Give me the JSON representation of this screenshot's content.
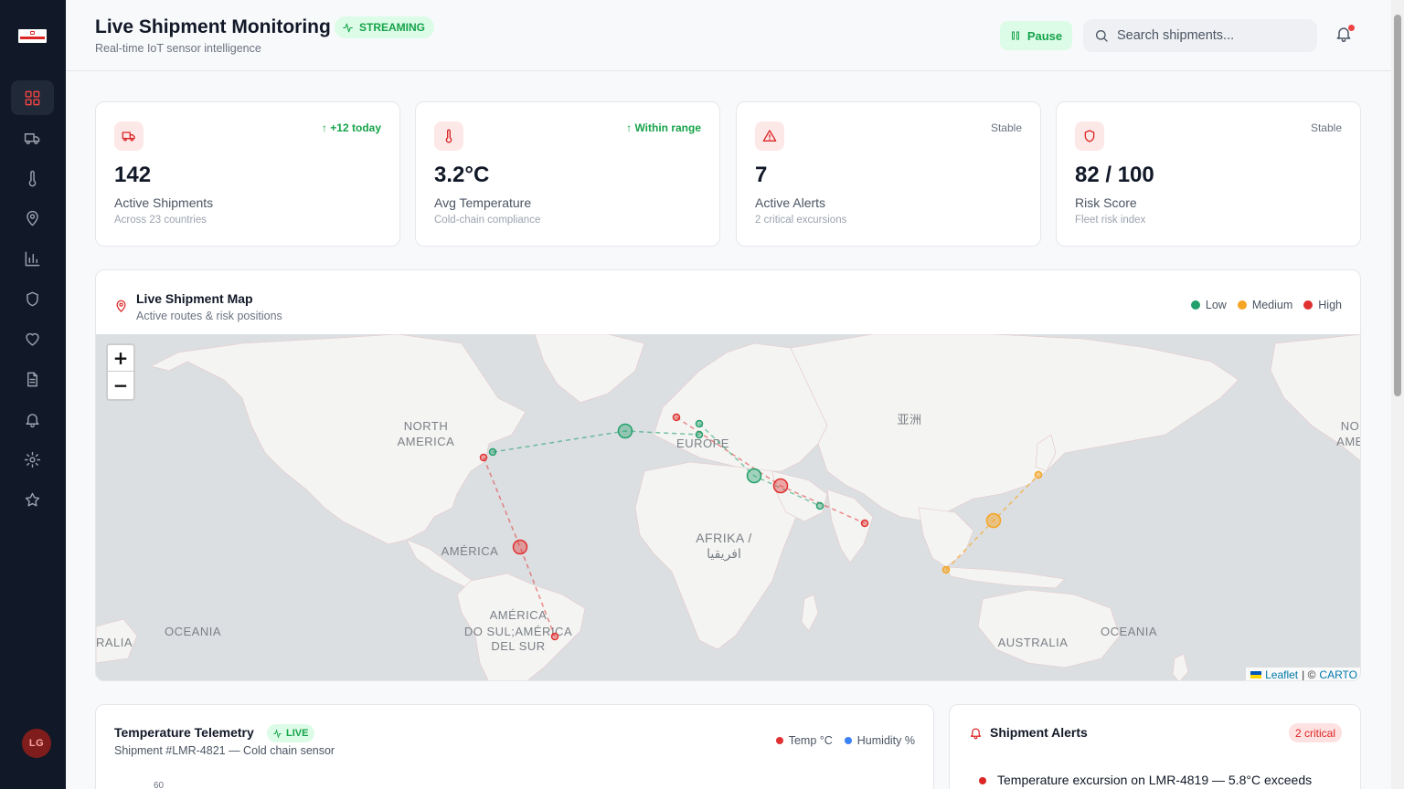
{
  "app": {
    "logo_text": "LAMBERGOLDBERG"
  },
  "sidebar": {
    "items": [
      {
        "name": "dashboard",
        "icon": "grid-icon"
      },
      {
        "name": "shipments",
        "icon": "truck-icon"
      },
      {
        "name": "temperature",
        "icon": "thermometer-icon"
      },
      {
        "name": "locations",
        "icon": "map-pin-icon"
      },
      {
        "name": "analytics",
        "icon": "bar-chart-icon"
      },
      {
        "name": "security",
        "icon": "shield-icon"
      },
      {
        "name": "health",
        "icon": "heart-icon"
      },
      {
        "name": "reports",
        "icon": "document-icon"
      },
      {
        "name": "notifications",
        "icon": "bell-icon"
      },
      {
        "name": "settings",
        "icon": "gear-icon"
      },
      {
        "name": "favorites",
        "icon": "star-icon"
      }
    ],
    "user_initials": "LG"
  },
  "header": {
    "title": "Live Shipment Monitoring",
    "badge": "STREAMING",
    "subtitle": "Real-time IoT sensor intelligence",
    "pause_label": "Pause",
    "search_placeholder": "Search shipments..."
  },
  "stats": [
    {
      "icon": "truck-icon",
      "trend": "↑ +12 today",
      "trend_type": "up",
      "value": "142",
      "label": "Active Shipments",
      "sub": "Across 23 countries"
    },
    {
      "icon": "thermometer-icon",
      "trend": "↑ Within range",
      "trend_type": "up",
      "value": "3.2°C",
      "label": "Avg Temperature",
      "sub": "Cold-chain compliance"
    },
    {
      "icon": "alert-triangle-icon",
      "trend": "Stable",
      "trend_type": "neutral",
      "value": "7",
      "label": "Active Alerts",
      "sub": "2 critical excursions"
    },
    {
      "icon": "shield-icon",
      "trend": "Stable",
      "trend_type": "neutral",
      "value": "82 / 100",
      "label": "Risk Score",
      "sub": "Fleet risk index"
    }
  ],
  "map": {
    "title": "Live Shipment Map",
    "subtitle": "Active routes & risk positions",
    "legend": [
      {
        "label": "Low",
        "color": "#22a06b"
      },
      {
        "label": "Medium",
        "color": "#f5a524"
      },
      {
        "label": "High",
        "color": "#e03131"
      }
    ],
    "region_labels": {
      "north_america": [
        "NORTH",
        "AMERICA"
      ],
      "europe": "EUROPE",
      "asia": "亚洲",
      "north_america_right": [
        "NO",
        "AME"
      ],
      "africa": [
        "AFRIKA /",
        "افريقيا"
      ],
      "south_america_top": "AMÉRICA",
      "south_america": [
        "AMÉRICA",
        "DO SUL;AMÉRICA",
        "DEL SUR"
      ],
      "oceania_left": "OCEANIA",
      "australia_left": "RALIA",
      "australia": "AUSTRALIA",
      "oceania_right": "OCEANIA"
    },
    "zoom_in": "+",
    "zoom_out": "−",
    "attribution_leaflet": "Leaflet",
    "attribution_sep": "| ©",
    "attribution_carto": "CARTO"
  },
  "telemetry": {
    "title": "Temperature Telemetry",
    "badge": "LIVE",
    "subtitle": "Shipment #LMR-4821 — Cold chain sensor",
    "legend": [
      {
        "label": "Temp °C",
        "color": "#e03131"
      },
      {
        "label": "Humidity %",
        "color": "#3b82f6"
      }
    ],
    "y_tick_top": "60"
  },
  "alerts": {
    "title": "Shipment Alerts",
    "badge": "2 critical",
    "items": [
      {
        "text": "Temperature excursion on LMR-4819 — 5.8°C exceeds",
        "severity_color": "#dc2626"
      }
    ]
  }
}
